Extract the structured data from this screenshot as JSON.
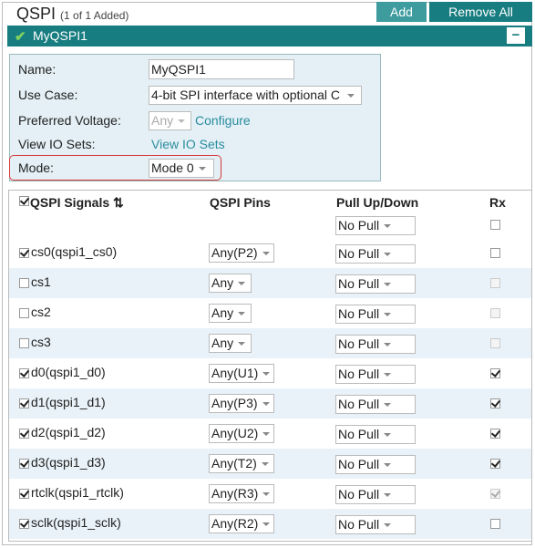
{
  "header": {
    "title": "QSPI",
    "count": "(1 of 1 Added)",
    "add_label": "Add",
    "remove_all_label": "Remove All"
  },
  "instance": {
    "name": "MyQSPI1",
    "collapse_label": "−"
  },
  "form": {
    "name_label": "Name:",
    "name_value": "MyQSPI1",
    "use_case_label": "Use Case:",
    "use_case_value": "4-bit SPI interface with optional C",
    "voltage_label": "Preferred Voltage:",
    "voltage_value": "Any",
    "configure_label": "Configure",
    "io_sets_label": "View IO Sets:",
    "io_sets_link": "View IO Sets",
    "mode_label": "Mode:",
    "mode_value": "Mode 0"
  },
  "table": {
    "col_signals": "QSPI Signals",
    "col_pins": "QSPI Pins",
    "col_pull": "Pull Up/Down",
    "col_rx": "Rx",
    "header_pull_value": "No Pull",
    "rows": [
      {
        "signal": "cs0(qspi1_cs0)",
        "pin": "Any(P2)",
        "pull": "No Pull",
        "checked": true,
        "rx": false,
        "rx_disabled": false
      },
      {
        "signal": "cs1",
        "pin": "Any",
        "pull": "No Pull",
        "checked": false,
        "rx": false,
        "rx_disabled": true
      },
      {
        "signal": "cs2",
        "pin": "Any",
        "pull": "No Pull",
        "checked": false,
        "rx": false,
        "rx_disabled": true
      },
      {
        "signal": "cs3",
        "pin": "Any",
        "pull": "No Pull",
        "checked": false,
        "rx": false,
        "rx_disabled": true
      },
      {
        "signal": "d0(qspi1_d0)",
        "pin": "Any(U1)",
        "pull": "No Pull",
        "checked": true,
        "rx": true,
        "rx_disabled": false
      },
      {
        "signal": "d1(qspi1_d1)",
        "pin": "Any(P3)",
        "pull": "No Pull",
        "checked": true,
        "rx": true,
        "rx_disabled": false
      },
      {
        "signal": "d2(qspi1_d2)",
        "pin": "Any(U2)",
        "pull": "No Pull",
        "checked": true,
        "rx": true,
        "rx_disabled": false
      },
      {
        "signal": "d3(qspi1_d3)",
        "pin": "Any(T2)",
        "pull": "No Pull",
        "checked": true,
        "rx": true,
        "rx_disabled": false
      },
      {
        "signal": "rtclk(qspi1_rtclk)",
        "pin": "Any(R3)",
        "pull": "No Pull",
        "checked": true,
        "rx": true,
        "rx_disabled": true
      },
      {
        "signal": "sclk(qspi1_sclk)",
        "pin": "Any(R2)",
        "pull": "No Pull",
        "checked": true,
        "rx": false,
        "rx_disabled": false
      }
    ]
  },
  "colors": {
    "accent": "#187d80",
    "add_button": "#3e9c9e",
    "panel_bg": "#e4f0f6",
    "alt_row": "#e8f2f8",
    "highlight": "#d63a3a"
  }
}
